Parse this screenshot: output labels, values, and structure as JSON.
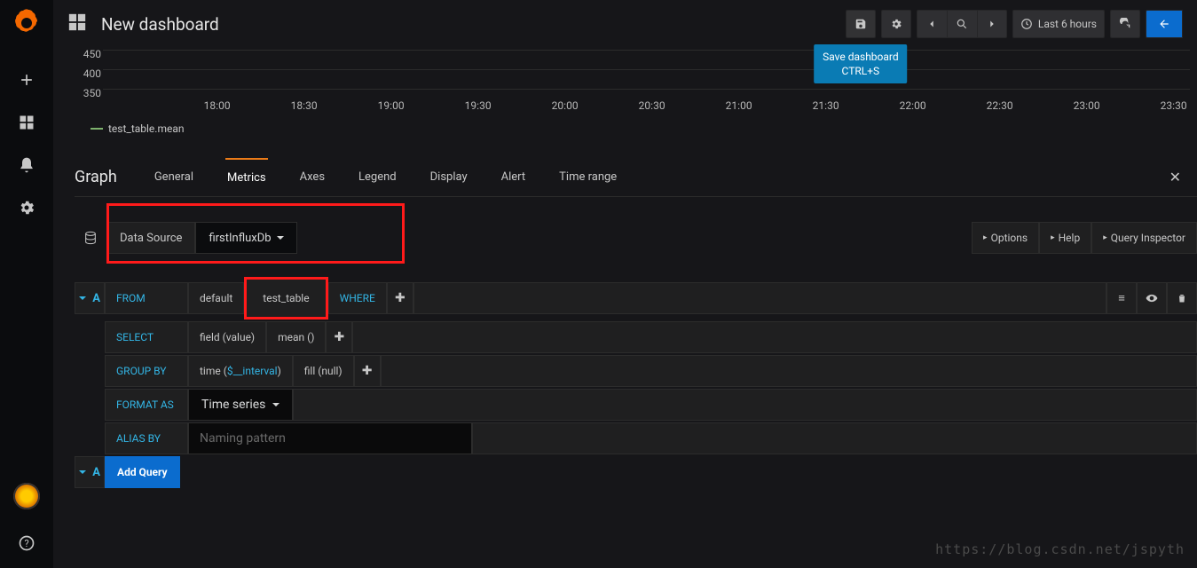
{
  "dashboard_title": "New dashboard",
  "tooltip": {
    "line1": "Save dashboard",
    "line2": "CTRL+S"
  },
  "time_picker": "Last 6 hours",
  "chart": {
    "y_ticks": [
      "450",
      "400",
      "350"
    ],
    "x_ticks": [
      "18:00",
      "18:30",
      "19:00",
      "19:30",
      "20:00",
      "20:30",
      "21:00",
      "21:30",
      "22:00",
      "22:30",
      "23:00",
      "23:30"
    ],
    "legend": "test_table.mean"
  },
  "chart_data": {
    "type": "line",
    "title": "",
    "xlabel": "",
    "ylabel": "",
    "ylim": [
      350,
      450
    ],
    "categories": [
      "18:00",
      "18:30",
      "19:00",
      "19:30",
      "20:00",
      "20:30",
      "21:00",
      "21:30",
      "22:00",
      "22:30",
      "23:00",
      "23:30"
    ],
    "series": [
      {
        "name": "test_table.mean",
        "values": [
          null,
          null,
          null,
          null,
          null,
          null,
          null,
          null,
          null,
          null,
          null,
          null
        ]
      }
    ]
  },
  "editor": {
    "title": "Graph",
    "tabs": [
      "General",
      "Metrics",
      "Axes",
      "Legend",
      "Display",
      "Alert",
      "Time range"
    ],
    "active_tab": "Metrics"
  },
  "datasource": {
    "label": "Data Source",
    "value": "firstInfluxDb"
  },
  "ds_options": {
    "options": "Options",
    "help": "Help",
    "inspector": "Query Inspector"
  },
  "queryA": {
    "letter": "A",
    "from": "FROM",
    "from_default": "default",
    "from_table": "test_table",
    "where": "WHERE",
    "select": "SELECT",
    "select_field": "field (value)",
    "select_agg": "mean ()",
    "groupby": "GROUP BY",
    "groupby_time_pre": "time (",
    "groupby_time_param": "$__interval",
    "groupby_time_post": ")",
    "groupby_fill": "fill (null)",
    "format": "FORMAT AS",
    "format_value": "Time series",
    "alias": "ALIAS BY",
    "alias_placeholder": "Naming pattern"
  },
  "add_query": "Add Query",
  "watermark": "https://blog.csdn.net/jspyth"
}
